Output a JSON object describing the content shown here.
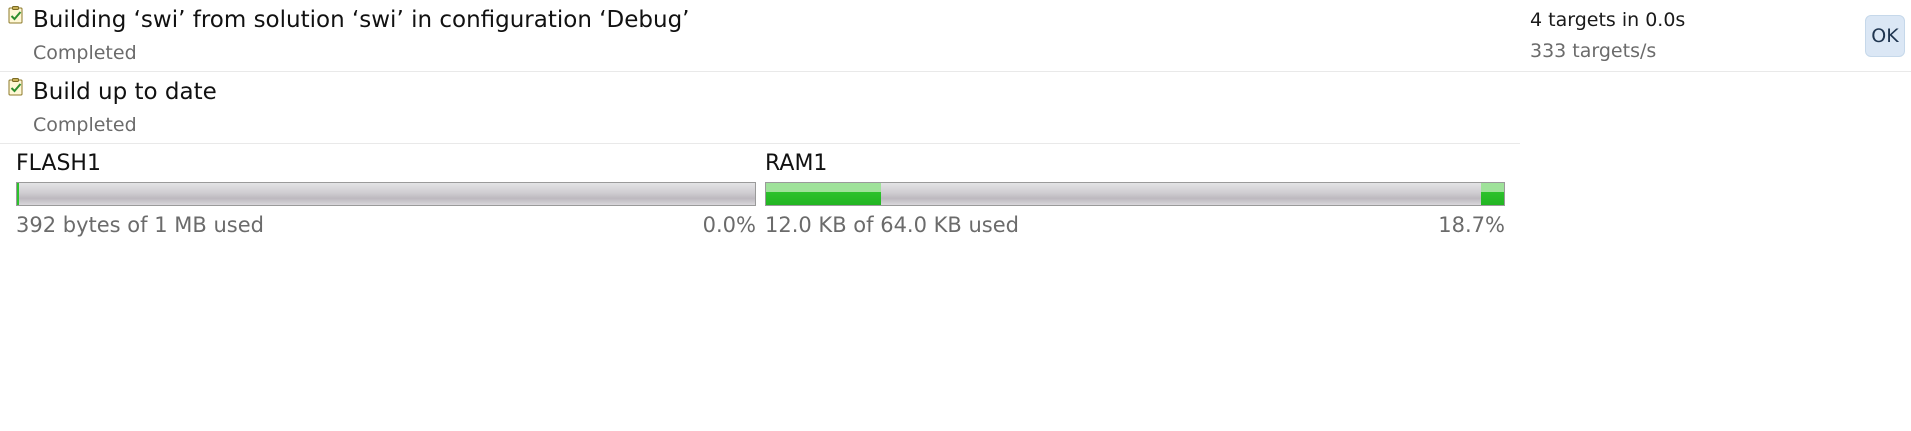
{
  "build_entries": [
    {
      "title": "Building ‘swi’ from solution ‘swi’ in configuration ‘Debug’",
      "status": "Completed",
      "icon": "checklist-icon"
    },
    {
      "title": "Build up to date",
      "status": "Completed",
      "icon": "checklist-icon"
    }
  ],
  "stats": {
    "targets": "4 targets in 0.0s",
    "rate": "333 targets/s"
  },
  "ok_button": {
    "label": "OK"
  },
  "memory": [
    {
      "name": "FLASH1",
      "usage": "392 bytes of 1 MB used",
      "percent": "0.0%",
      "used_fraction": 0.0004
    },
    {
      "name": "RAM1",
      "usage": "12.0 KB of 64.0 KB used",
      "percent": "18.7%",
      "used_fraction": 0.187,
      "segments": [
        {
          "start": 0.0,
          "end": 0.156
        },
        {
          "start": 0.969,
          "end": 1.0
        }
      ]
    }
  ],
  "colors": {
    "bar_used": "#22b522",
    "bar_used_light": "#9fe29a",
    "bar_track": "#cfcdd1",
    "ok_button_bg": "#dbe7f5"
  }
}
